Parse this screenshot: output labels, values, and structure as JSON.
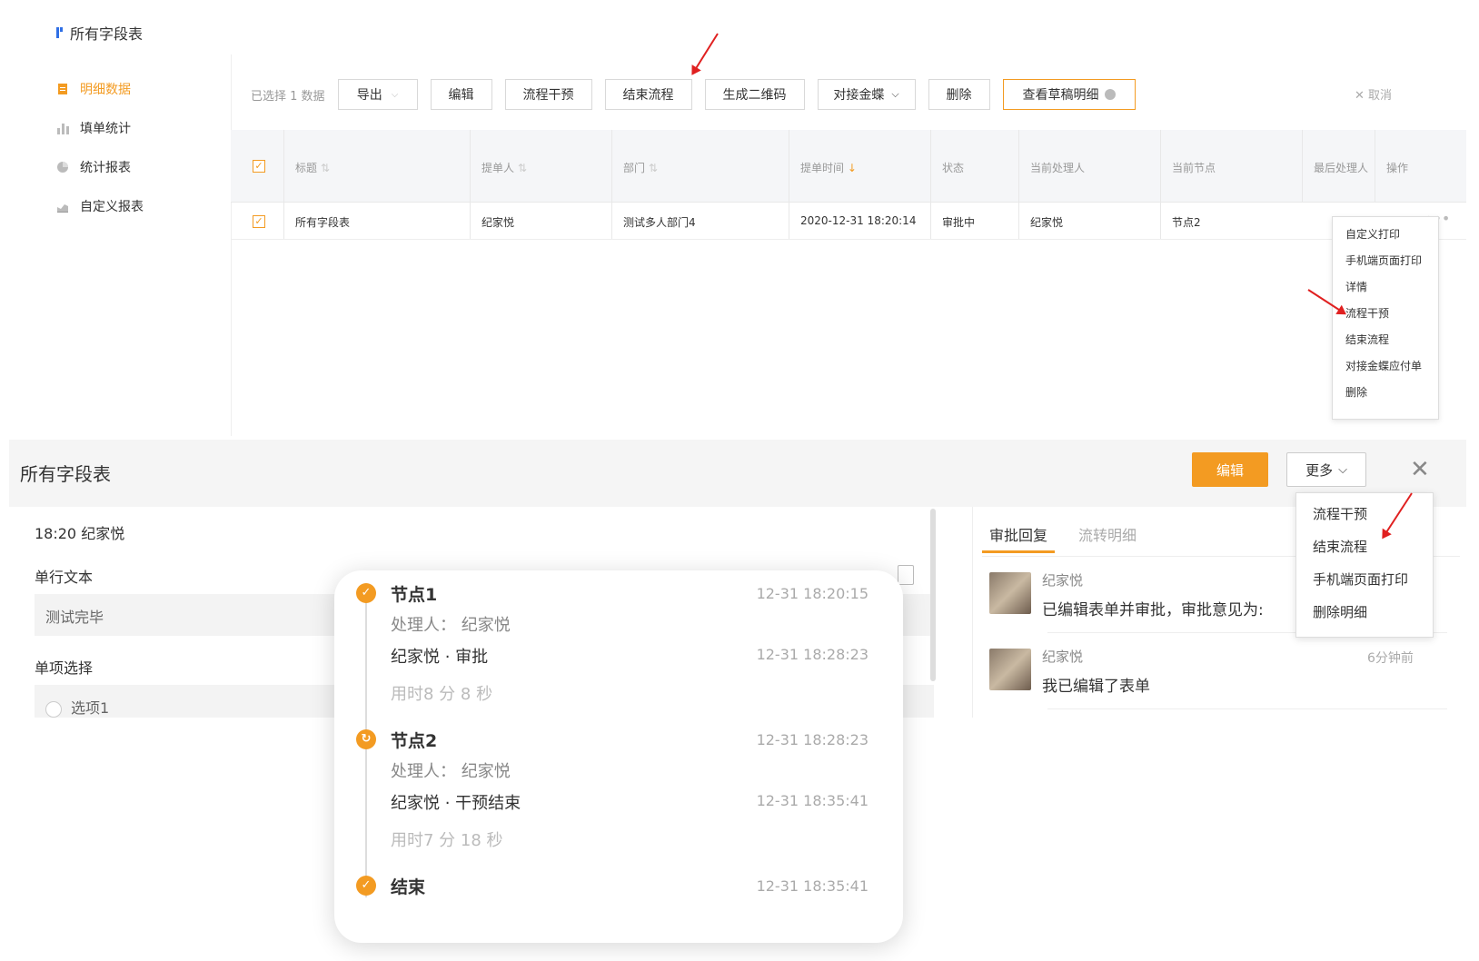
{
  "app": {
    "title": "所有字段表"
  },
  "sidebar": {
    "items": [
      {
        "label": "明细数据",
        "icon": "doc-icon",
        "active": true
      },
      {
        "label": "填单统计",
        "icon": "bar-chart-icon"
      },
      {
        "label": "统计报表",
        "icon": "pie-chart-icon"
      },
      {
        "label": "自定义报表",
        "icon": "area-chart-icon"
      }
    ]
  },
  "toolbar": {
    "selected_note": "已选择 1 数据",
    "buttons": [
      "导出",
      "编辑",
      "流程干预",
      "结束流程",
      "生成二维码",
      "对接金蝶",
      "删除",
      "查看草稿明细"
    ],
    "cancel": "取消"
  },
  "table": {
    "headers": [
      "标题",
      "提单人",
      "部门",
      "提单时间",
      "状态",
      "当前处理人",
      "当前节点",
      "最后处理人",
      "操作"
    ],
    "rows": [
      {
        "title": "所有字段表",
        "submitter": "纪家悦",
        "dept": "测试多人部门4",
        "time": "2020-12-31 18:20:14",
        "status": "审批中",
        "handler": "纪家悦",
        "node": "节点2"
      }
    ]
  },
  "row_menu": [
    "自定义打印",
    "手机端页面打印",
    "详情",
    "流程干预",
    "结束流程",
    "对接金蝶应付单",
    "删除"
  ],
  "detail": {
    "title": "所有字段表",
    "edit_label": "编辑",
    "more_label": "更多",
    "more_menu": [
      "流程干预",
      "结束流程",
      "手机端页面打印",
      "删除明细"
    ],
    "meta": "18:20   纪家悦",
    "fields": [
      {
        "label": "单行文本",
        "value": "测试完毕"
      },
      {
        "label": "单项选择",
        "value": "选项1"
      }
    ],
    "tabs": [
      "审批回复",
      "流转明细"
    ],
    "comments": [
      {
        "name": "纪家悦",
        "text": "已编辑表单并审批，审批意见为:",
        "time": ""
      },
      {
        "name": "纪家悦",
        "text": "我已编辑了表单",
        "time": "6分钟前"
      }
    ]
  },
  "timeline": {
    "nodes": [
      {
        "name": "节点1",
        "time": "12-31 18:20:15",
        "handler": "处理人： 纪家悦",
        "action": "纪家悦 · 审批",
        "action_time": "12-31 18:28:23",
        "duration": "用时8 分 8 秒"
      },
      {
        "name": "节点2",
        "time": "12-31 18:28:23",
        "handler": "处理人： 纪家悦",
        "action": "纪家悦 · 干预结束",
        "action_time": "12-31 18:35:41",
        "duration": "用时7 分 18 秒"
      },
      {
        "name": "结束",
        "time": "12-31 18:35:41"
      }
    ]
  },
  "colors": {
    "accent": "#f39b22",
    "arrow": "#e02020"
  }
}
